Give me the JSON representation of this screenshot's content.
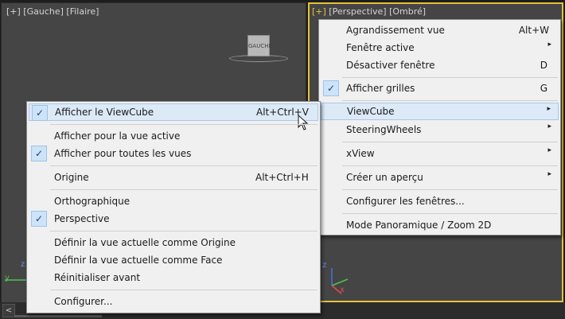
{
  "viewport_left": {
    "label": "[+] [Gauche] [Filaire]",
    "cube_label": "GAUCHE",
    "axis_y": "y",
    "axis_z": "z"
  },
  "viewport_right": {
    "label_plus": "[+]",
    "label_rest": " [Perspective] [Ombré]",
    "axis_z": "z",
    "axis_x": "x"
  },
  "scrollbar": {
    "left_arrow": "<"
  },
  "main_menu": {
    "items": [
      {
        "label": "Agrandissement vue",
        "shortcut": "Alt+W"
      },
      {
        "label": "Fenêtre active",
        "submenu": "▸"
      },
      {
        "label": "Désactiver fenêtre",
        "shortcut": "D"
      },
      {
        "label": "Afficher grilles",
        "shortcut": "G",
        "checked": "✓"
      },
      {
        "label": "ViewCube",
        "submenu": "▸"
      },
      {
        "label": "SteeringWheels",
        "submenu": "▸"
      },
      {
        "label": "xView",
        "submenu": "▸"
      },
      {
        "label": "Créer un aperçu",
        "submenu": "▸"
      },
      {
        "label": "Configurer les fenêtres..."
      },
      {
        "label": "Mode Panoramique / Zoom 2D"
      }
    ]
  },
  "viewcube_menu": {
    "items": [
      {
        "label": "Afficher le ViewCube",
        "shortcut": "Alt+Ctrl+V",
        "checked": "✓"
      },
      {
        "label": "Afficher pour la vue active"
      },
      {
        "label": "Afficher pour toutes les vues",
        "checked": "✓"
      },
      {
        "label": "Origine",
        "shortcut": "Alt+Ctrl+H"
      },
      {
        "label": "Orthographique"
      },
      {
        "label": "Perspective",
        "checked": "✓"
      },
      {
        "label": "Définir la vue actuelle comme Origine"
      },
      {
        "label": "Définir la vue actuelle comme Face"
      },
      {
        "label": "Réinitialiser avant"
      },
      {
        "label": "Configurer..."
      }
    ]
  },
  "colors": {
    "active_border": "#e6c23a",
    "menu_bg": "#f0f0f0",
    "highlight": "#dce9f7",
    "check_bg": "#cde3f7"
  }
}
